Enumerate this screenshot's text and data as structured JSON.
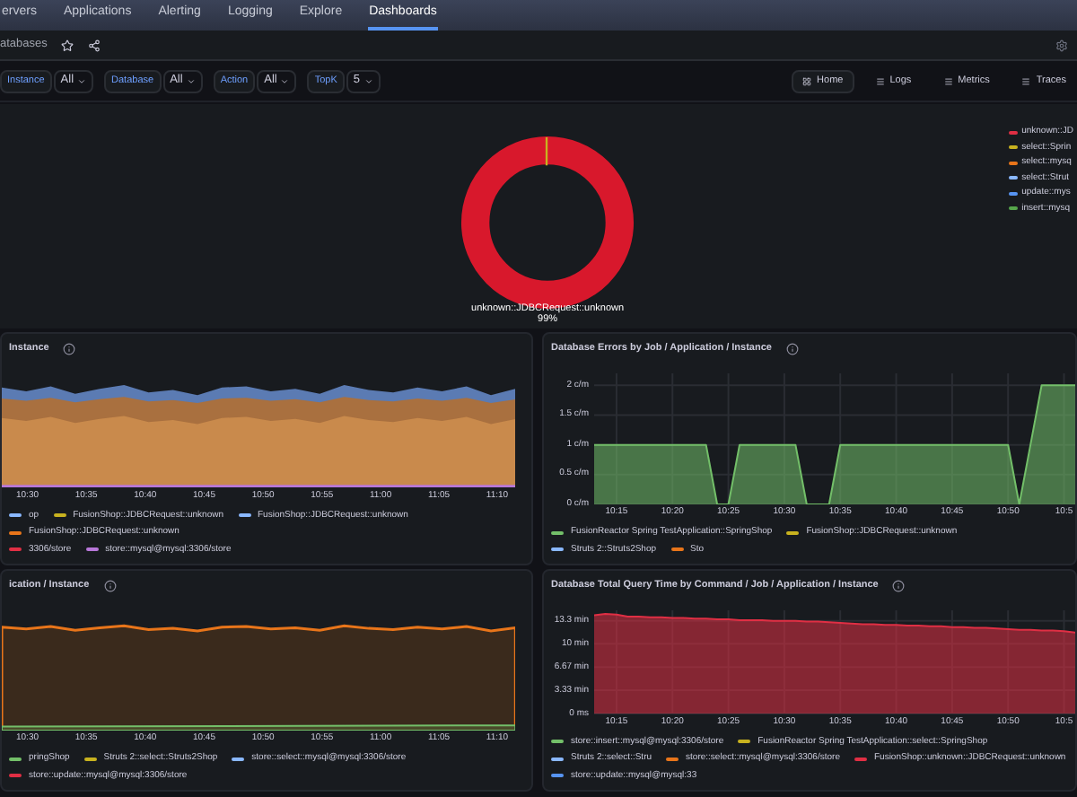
{
  "nav": {
    "items": [
      {
        "label": "ervers",
        "selected": false
      },
      {
        "label": "Applications",
        "selected": false
      },
      {
        "label": "Alerting",
        "selected": false
      },
      {
        "label": "Logging",
        "selected": false
      },
      {
        "label": "Explore",
        "selected": false
      },
      {
        "label": "Dashboards",
        "selected": true
      }
    ]
  },
  "breadcrumb": {
    "title": "atabases"
  },
  "variables": [
    {
      "label": "Instance",
      "value": "All"
    },
    {
      "label": "Database",
      "value": "All"
    },
    {
      "label": "Action",
      "value": "All"
    },
    {
      "label": "TopK",
      "value": "5"
    }
  ],
  "links": [
    {
      "label": "Home",
      "selected": true
    },
    {
      "label": "Logs",
      "selected": false
    },
    {
      "label": "Metrics",
      "selected": false
    },
    {
      "label": "Traces",
      "selected": false
    }
  ],
  "donut_panel": {
    "slice_label": "unknown::JDBCRequest::unknown",
    "slice_value": "99%",
    "legend": [
      {
        "label": "unknown::JD",
        "color": "#e02f44"
      },
      {
        "label": "select::Sprin",
        "color": "#c8b21f"
      },
      {
        "label": "select::mysq",
        "color": "#e8751a"
      },
      {
        "label": "select::Strut",
        "color": "#8ab8ff"
      },
      {
        "label": "update::mys",
        "color": "#5794f2"
      },
      {
        "label": "insert::mysq",
        "color": "#56a64b"
      }
    ]
  },
  "panels": [
    {
      "kind": "stacked_picture",
      "title": "Instance",
      "x_ticks": [
        "10:30",
        "10:35",
        "10:40",
        "10:45",
        "10:50",
        "10:55",
        "11:00",
        "11:05",
        "11:10"
      ],
      "legend": [
        [
          {
            "label": "op",
            "color": "#8ab8ff"
          },
          {
            "label": "FusionShop::JDBCRequest::unknown",
            "color": "#c8b21f"
          },
          {
            "label": "FusionShop::JDBCRequest::unknown",
            "color": "#8ab8ff"
          },
          {
            "label": "FusionShop::JDBCRequest::unknown",
            "color": "#e8751a"
          }
        ],
        [
          {
            "label": "3306/store",
            "color": "#e02f44"
          },
          {
            "label": "store::mysql@mysql:3306/store",
            "color": "#b877d9"
          }
        ]
      ]
    },
    {
      "kind": "chart",
      "title": "Database Errors by Job / Application / Instance",
      "chart_data": {
        "type": "area",
        "grid": true,
        "categories": [
          null,
          null,
          "10:15",
          null,
          null,
          null,
          null,
          "10:20",
          null,
          null,
          null,
          null,
          "10:25",
          null,
          null,
          null,
          null,
          "10:30",
          null,
          null,
          null,
          null,
          "10:35",
          null,
          null,
          null,
          null,
          "10:40",
          null,
          null,
          null,
          null,
          "10:45",
          null,
          null,
          null,
          null,
          "10:50",
          null,
          null,
          null,
          null,
          "10:5",
          null
        ],
        "ylim": [
          0,
          2.2
        ],
        "yticks": [
          {
            "value": 0,
            "label": "0 c/m"
          },
          {
            "value": 0.5,
            "label": "0.5 c/m"
          },
          {
            "value": 1,
            "label": "1 c/m"
          },
          {
            "value": 1.5,
            "label": "1.5 c/m"
          },
          {
            "value": 2,
            "label": "2 c/m"
          }
        ],
        "series": [
          {
            "color": "#73bf69",
            "values": [
              1,
              1,
              1,
              1,
              1,
              1,
              1,
              1,
              1,
              1,
              1,
              0,
              0,
              1,
              1,
              1,
              1,
              1,
              1,
              0,
              0,
              0,
              1,
              1,
              1,
              1,
              1,
              1,
              1,
              1,
              1,
              1,
              1,
              1,
              1,
              1,
              1,
              1,
              0,
              1,
              2,
              2,
              2,
              2
            ]
          }
        ]
      },
      "legend": [
        [
          {
            "label": "FusionReactor Spring TestApplication::SpringShop",
            "color": "#73bf69"
          },
          {
            "label": "FusionShop::JDBCRequest::unknown",
            "color": "#c8b21f"
          },
          {
            "label": "Struts 2::Struts2Shop",
            "color": "#8ab8ff"
          },
          {
            "label": "Sto",
            "color": "#e8751a"
          }
        ]
      ]
    },
    {
      "kind": "line_picture",
      "title": "ication / Instance",
      "x_ticks": [
        "10:30",
        "10:35",
        "10:40",
        "10:45",
        "10:50",
        "10:55",
        "11:00",
        "11:05",
        "11:10"
      ],
      "legend": [
        [
          {
            "label": "pringShop",
            "color": "#73bf69"
          },
          {
            "label": "Struts 2::select::Struts2Shop",
            "color": "#c8b21f"
          },
          {
            "label": "store::select::mysql@mysql:3306/store",
            "color": "#8ab8ff"
          }
        ],
        [
          {
            "label": "store::update::mysql@mysql:3306/store",
            "color": "#e02f44"
          }
        ]
      ]
    },
    {
      "kind": "chart",
      "title": "Database Total Query Time by Command / Job / Application / Instance",
      "chart_data": {
        "type": "area",
        "grid": true,
        "categories": [
          null,
          null,
          "10:15",
          null,
          null,
          null,
          null,
          "10:20",
          null,
          null,
          null,
          null,
          "10:25",
          null,
          null,
          null,
          null,
          "10:30",
          null,
          null,
          null,
          null,
          "10:35",
          null,
          null,
          null,
          null,
          "10:40",
          null,
          null,
          null,
          null,
          "10:45",
          null,
          null,
          null,
          null,
          "10:50",
          null,
          null,
          null,
          null,
          "10:5",
          null
        ],
        "ylim": [
          0,
          14.8
        ],
        "yticks": [
          {
            "value": 0,
            "label": "0 ms"
          },
          {
            "value": 3.33,
            "label": "3.33 min"
          },
          {
            "value": 6.67,
            "label": "6.67 min"
          },
          {
            "value": 10,
            "label": "10 min"
          },
          {
            "value": 13.3,
            "label": "13.3 min"
          }
        ],
        "series": [
          {
            "color": "#e02f44",
            "values": [
              14.1,
              14.3,
              14.2,
              13.9,
              13.9,
              13.8,
              13.8,
              13.7,
              13.7,
              13.6,
              13.6,
              13.5,
              13.5,
              13.4,
              13.4,
              13.4,
              13.3,
              13.3,
              13.3,
              13.2,
              13.2,
              13.1,
              13.0,
              12.9,
              12.8,
              12.8,
              12.7,
              12.7,
              12.6,
              12.6,
              12.5,
              12.5,
              12.4,
              12.4,
              12.3,
              12.3,
              12.2,
              12.1,
              12.0,
              12.0,
              11.9,
              11.9,
              11.8,
              11.6
            ]
          }
        ]
      },
      "legend": [
        [
          {
            "label": "store::insert::mysql@mysql:3306/store",
            "color": "#73bf69"
          },
          {
            "label": "FusionReactor Spring TestApplication::select::SpringShop",
            "color": "#c8b21f"
          },
          {
            "label": "Struts 2::select::Stru",
            "color": "#8ab8ff"
          },
          {
            "label": "store::select::mysql@mysql:3306/store",
            "color": "#e8751a"
          },
          {
            "label": "FusionShop::unknown::JDBCRequest::unknown",
            "color": "#e02f44"
          },
          {
            "label": "store::update::mysql@mysql:33",
            "color": "#5794f2"
          }
        ]
      ]
    }
  ]
}
